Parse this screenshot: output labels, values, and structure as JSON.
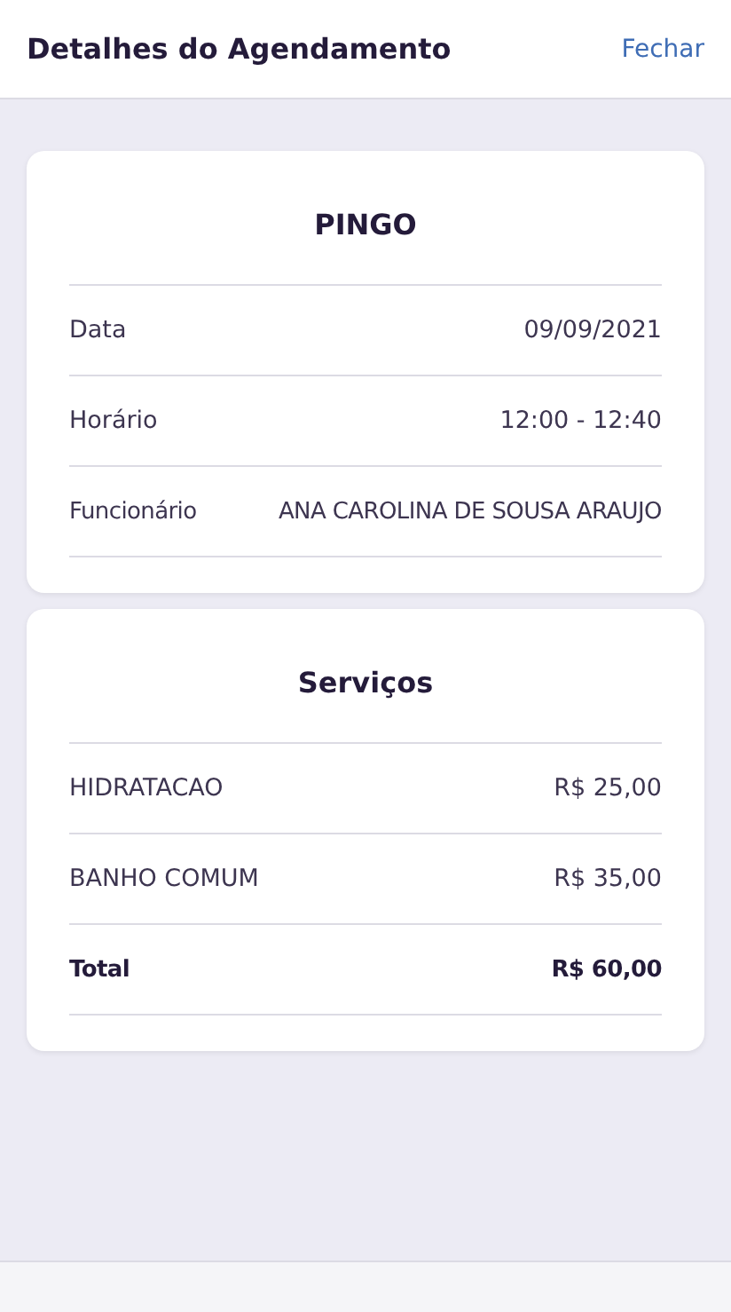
{
  "header": {
    "title": "Detalhes do Agendamento",
    "close_link": "Fechar"
  },
  "cards": [
    {
      "title": "PINGO",
      "rows": [
        {
          "kind": "item",
          "label": "Data",
          "value": "09/09/2021"
        },
        {
          "kind": "item",
          "label": "Horário",
          "value": "12:00 - 12:40"
        },
        {
          "kind": "item",
          "label": "Funcionário",
          "value": "ANA CAROLINA DE SOUSA ARAUJO"
        }
      ]
    },
    {
      "title": "Serviços",
      "rows": [
        {
          "kind": "item",
          "label": "HIDRATACAO",
          "value": "R$ 25,00"
        },
        {
          "kind": "item",
          "label": "BANHO COMUM",
          "value": "R$ 35,00"
        },
        {
          "kind": "total",
          "label": "Total",
          "value": "R$ 60,00"
        }
      ]
    }
  ]
}
